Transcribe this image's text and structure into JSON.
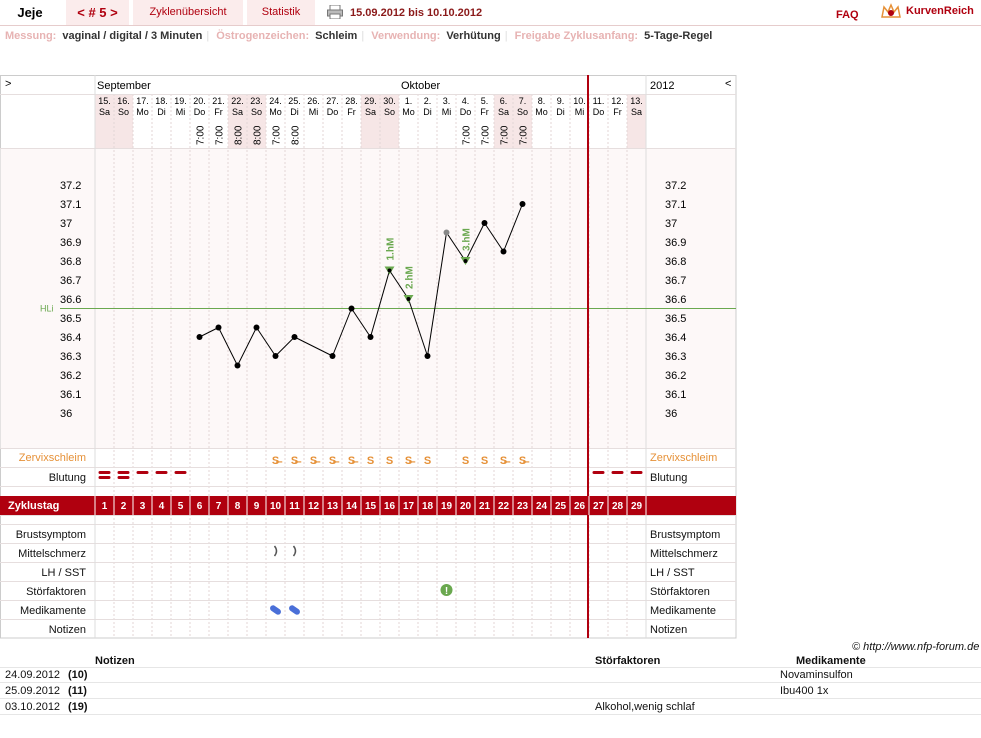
{
  "header": {
    "user": "Jeje",
    "cycle": "< # 5 >",
    "overview": "Zyklenübersicht",
    "stats": "Statistik",
    "daterange": "15.09.2012 bis 10.10.2012",
    "faq": "FAQ",
    "logo": "KurvenReich"
  },
  "meta": [
    {
      "label": "Messung:",
      "value": "vaginal / digital / 3 Minuten"
    },
    {
      "label": "Östrogenzeichen:",
      "value": "Schleim"
    },
    {
      "label": "Verwendung:",
      "value": "Verhütung"
    },
    {
      "label": "Freigabe Zyklusanfang:",
      "value": "5-Tage-Regel"
    }
  ],
  "chart_header": {
    "left_arrow": ">",
    "right_arrow": "<",
    "month1": "September",
    "month2": "Oktober",
    "year": "2012"
  },
  "chart_data": {
    "type": "line",
    "days": [
      {
        "date": "15.",
        "wd": "Sa",
        "time": "",
        "cycle_day": 1,
        "weekend": true
      },
      {
        "date": "16.",
        "wd": "So",
        "time": "",
        "cycle_day": 2,
        "weekend": true
      },
      {
        "date": "17.",
        "wd": "Mo",
        "time": "",
        "cycle_day": 3,
        "weekend": false
      },
      {
        "date": "18.",
        "wd": "Di",
        "time": "",
        "cycle_day": 4,
        "weekend": false
      },
      {
        "date": "19.",
        "wd": "Mi",
        "time": "",
        "cycle_day": 5,
        "weekend": false
      },
      {
        "date": "20.",
        "wd": "Do",
        "time": "7:00",
        "cycle_day": 6,
        "weekend": false
      },
      {
        "date": "21.",
        "wd": "Fr",
        "time": "7:00",
        "cycle_day": 7,
        "weekend": false
      },
      {
        "date": "22.",
        "wd": "Sa",
        "time": "8:00",
        "cycle_day": 8,
        "weekend": true
      },
      {
        "date": "23.",
        "wd": "So",
        "time": "8:00",
        "cycle_day": 9,
        "weekend": true
      },
      {
        "date": "24.",
        "wd": "Mo",
        "time": "7:00",
        "cycle_day": 10,
        "weekend": false
      },
      {
        "date": "25.",
        "wd": "Di",
        "time": "8:00",
        "cycle_day": 11,
        "weekend": false
      },
      {
        "date": "26.",
        "wd": "Mi",
        "time": "",
        "cycle_day": 12,
        "weekend": false
      },
      {
        "date": "27.",
        "wd": "Do",
        "time": "",
        "cycle_day": 13,
        "weekend": false
      },
      {
        "date": "28.",
        "wd": "Fr",
        "time": "",
        "cycle_day": 14,
        "weekend": false
      },
      {
        "date": "29.",
        "wd": "Sa",
        "time": "",
        "cycle_day": 15,
        "weekend": true
      },
      {
        "date": "30.",
        "wd": "So",
        "time": "",
        "cycle_day": 16,
        "weekend": true
      },
      {
        "date": "1.",
        "wd": "Mo",
        "time": "",
        "cycle_day": 17,
        "weekend": false
      },
      {
        "date": "2.",
        "wd": "Di",
        "time": "",
        "cycle_day": 18,
        "weekend": false
      },
      {
        "date": "3.",
        "wd": "Mi",
        "time": "",
        "cycle_day": 19,
        "weekend": false
      },
      {
        "date": "4.",
        "wd": "Do",
        "time": "7:00",
        "cycle_day": 20,
        "weekend": false
      },
      {
        "date": "5.",
        "wd": "Fr",
        "time": "7:00",
        "cycle_day": 21,
        "weekend": false
      },
      {
        "date": "6.",
        "wd": "Sa",
        "time": "7:00",
        "cycle_day": 22,
        "weekend": true
      },
      {
        "date": "7.",
        "wd": "So",
        "time": "7:00",
        "cycle_day": 23,
        "weekend": true
      },
      {
        "date": "8.",
        "wd": "Mo",
        "time": "",
        "cycle_day": 24,
        "weekend": false
      },
      {
        "date": "9.",
        "wd": "Di",
        "time": "",
        "cycle_day": 25,
        "weekend": false
      },
      {
        "date": "10.",
        "wd": "Mi",
        "time": "",
        "cycle_day": 26,
        "weekend": false
      },
      {
        "date": "11.",
        "wd": "Do",
        "time": "",
        "cycle_day": 27,
        "weekend": false
      },
      {
        "date": "12.",
        "wd": "Fr",
        "time": "",
        "cycle_day": 28,
        "weekend": false
      },
      {
        "date": "13.",
        "wd": "Sa",
        "time": "",
        "cycle_day": 29,
        "weekend": true
      }
    ],
    "temps": [
      null,
      null,
      null,
      null,
      null,
      36.4,
      36.45,
      36.25,
      36.45,
      36.3,
      36.4,
      null,
      36.3,
      36.55,
      36.4,
      36.75,
      36.6,
      36.3,
      36.95,
      36.8,
      37.0,
      36.85,
      37.1,
      null,
      null,
      null,
      null,
      null,
      null
    ],
    "yticks": [
      "37.2",
      "37.1",
      "37",
      "36.9",
      "36.8",
      "36.7",
      "36.6",
      "36.5",
      "36.4",
      "36.3",
      "36.2",
      "36.1",
      "36"
    ],
    "ylim": [
      36.0,
      37.2
    ],
    "coverline": {
      "label": "HLi",
      "value": 36.55
    },
    "markers": [
      {
        "day": 16,
        "label": "1.hM"
      },
      {
        "day": 17,
        "label": "2.hM"
      },
      {
        "day": 20,
        "label": "3.hM"
      }
    ],
    "mucus": [
      "",
      "",
      "",
      "",
      "",
      "",
      "",
      "",
      "",
      "S̶",
      "S̶",
      "S̶",
      "S̶",
      "S̶",
      "S",
      "S",
      "S̶",
      "S",
      "",
      "S",
      "S",
      "S̶",
      "S̶",
      "",
      "",
      "",
      "",
      "",
      ""
    ],
    "bleeding": [
      2,
      2,
      1,
      1,
      1,
      0,
      0,
      0,
      0,
      0,
      0,
      0,
      0,
      0,
      0,
      0,
      0,
      0,
      0,
      0,
      0,
      0,
      0,
      0,
      0,
      0,
      1,
      1,
      1
    ],
    "mittelschmerz_days": [
      10,
      11
    ],
    "stoerfaktor_days": [
      19
    ],
    "medikament_days": [
      10,
      11
    ],
    "colors": {
      "line": "#000000",
      "accent": "#b0000f",
      "coverline": "#6aa84f",
      "mucus": "#e69138",
      "marker": "#6aa84f",
      "pill": "#4a6fd8"
    }
  },
  "labels": {
    "zervix": "Zervixschleim",
    "blutung": "Blutung",
    "zyklustag": "Zyklustag",
    "brust": "Brustsymptom",
    "mittel": "Mittelschmerz",
    "lh": "LH / SST",
    "stoer": "Störfaktoren",
    "medi": "Medikamente",
    "notizen": "Notizen"
  },
  "footer": {
    "credit": "© http://www.nfp-forum.de",
    "col_notes": "Notizen",
    "col_stoer": "Störfaktoren",
    "col_medi": "Medikamente",
    "rows": [
      {
        "date": "24.09.2012",
        "day": "(10)",
        "note": "",
        "stoer": "",
        "medi": "Novaminsulfon"
      },
      {
        "date": "25.09.2012",
        "day": "(11)",
        "note": "",
        "stoer": "",
        "medi": "Ibu400 1x"
      },
      {
        "date": "03.10.2012",
        "day": "(19)",
        "note": "",
        "stoer": "Alkohol,wenig schlaf",
        "medi": ""
      }
    ]
  }
}
